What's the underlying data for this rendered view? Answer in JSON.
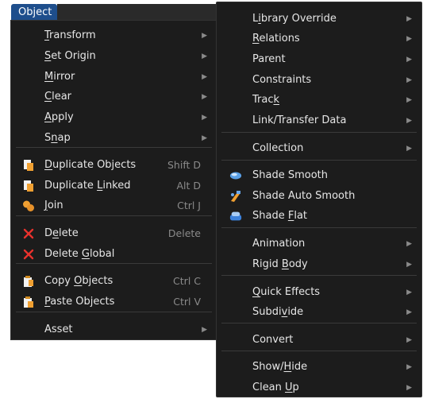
{
  "header": {
    "menu_title": "Object"
  },
  "left_menu": {
    "items": [
      {
        "label": "Transform",
        "ul": "T",
        "submenu": true
      },
      {
        "label": "Set Origin",
        "ul": "S",
        "submenu": true
      },
      {
        "label": "Mirror",
        "ul": "M",
        "submenu": true
      },
      {
        "label": "Clear",
        "ul": "C",
        "submenu": true
      },
      {
        "label": "Apply",
        "ul": "A",
        "submenu": true
      },
      {
        "label": "Snap",
        "ul": "n",
        "submenu": true
      },
      {
        "label": "Duplicate Objects",
        "ul": "D",
        "shortcut": "Shift D",
        "icon": "duplicate-icon"
      },
      {
        "label": "Duplicate Linked",
        "ul": "L",
        "shortcut": "Alt D",
        "icon": "duplicate-linked-icon"
      },
      {
        "label": "Join",
        "ul": "J",
        "shortcut": "Ctrl J",
        "icon": "join-icon"
      },
      {
        "label": "Delete",
        "ul": "e",
        "shortcut": "Delete",
        "icon": "delete-icon"
      },
      {
        "label": "Delete Global",
        "ul": "G",
        "icon": "delete-global-icon"
      },
      {
        "label": "Copy Objects",
        "ul": "O",
        "shortcut": "Ctrl C",
        "icon": "copy-icon"
      },
      {
        "label": "Paste Objects",
        "ul": "P",
        "shortcut": "Ctrl V",
        "icon": "paste-icon"
      },
      {
        "label": "Asset",
        "submenu": true
      }
    ]
  },
  "right_menu": {
    "items": [
      {
        "label": "Library Override",
        "ul": "i",
        "submenu": true
      },
      {
        "label": "Relations",
        "ul": "R",
        "submenu": true
      },
      {
        "label": "Parent",
        "ul": "",
        "submenu": true
      },
      {
        "label": "Constraints",
        "ul": "",
        "submenu": true
      },
      {
        "label": "Track",
        "ul": "k",
        "submenu": true
      },
      {
        "label": "Link/Transfer Data",
        "ul": "",
        "submenu": true
      },
      {
        "label": "Collection",
        "ul": "",
        "submenu": true
      },
      {
        "label": "Shade Smooth",
        "ul": "",
        "icon": "shade-smooth-icon"
      },
      {
        "label": "Shade Auto Smooth",
        "ul": "",
        "icon": "shade-auto-smooth-icon"
      },
      {
        "label": "Shade Flat",
        "ul": "F",
        "icon": "shade-flat-icon"
      },
      {
        "label": "Animation",
        "ul": "",
        "submenu": true
      },
      {
        "label": "Rigid Body",
        "ul": "B",
        "submenu": true
      },
      {
        "label": "Quick Effects",
        "ul": "Q",
        "submenu": true
      },
      {
        "label": "Subdivide",
        "ul": "v",
        "submenu": true
      },
      {
        "label": "Convert",
        "ul": "",
        "submenu": true
      },
      {
        "label": "Show/Hide",
        "ul": "H",
        "submenu": true
      },
      {
        "label": "Clean Up",
        "ul": "U",
        "submenu": true
      }
    ]
  },
  "colors": {
    "menu_bg": "#1c1c1c",
    "tab_active": "#1e4e8c",
    "shortcut_text": "#8a8a8a"
  }
}
